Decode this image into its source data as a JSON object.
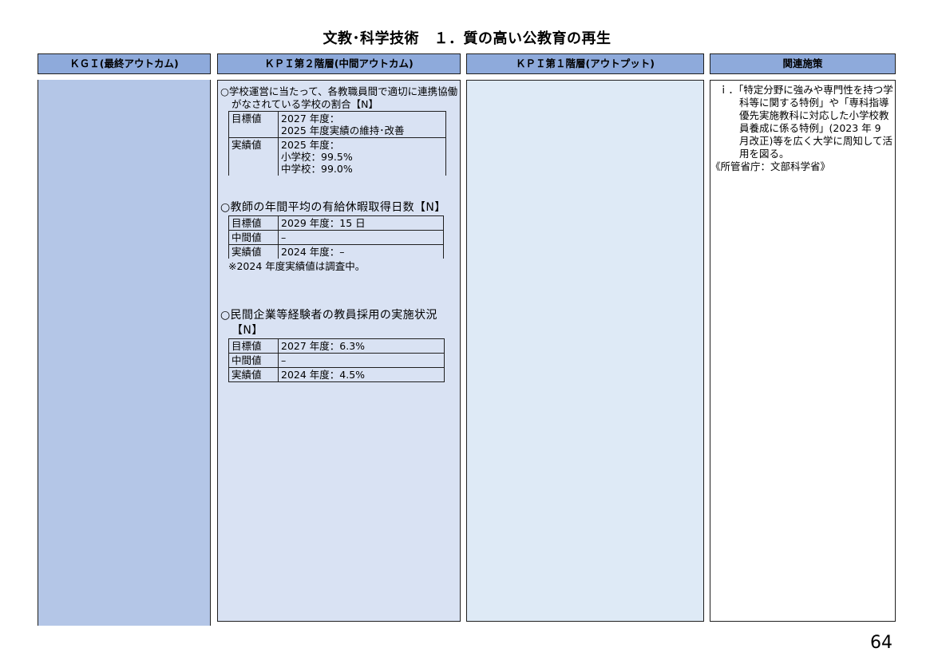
{
  "title": "文教･科学技術　１．質の高い公教育の再生",
  "headers": {
    "kgi": "ＫＧＩ(最終アウトカム)",
    "kpi2": "ＫＰＩ第２階層(中間アウトカム)",
    "kpi1": "ＫＰＩ第１階層(アウトプット)",
    "measures": "関連施策"
  },
  "kpi2": [
    {
      "title": "○学校運営に当たって、各教職員間で適切に連携協働がなされている学校の割合【N】",
      "rows": [
        {
          "key": "目標値",
          "lines": [
            "2027 年度：",
            "2025 年度実績の維持･改善"
          ]
        },
        {
          "key": "実績値",
          "lines": [
            "2025 年度：",
            "小学校：99.5%",
            "中学校：99.0%"
          ]
        }
      ]
    },
    {
      "title": "○教師の年間平均の有給休暇取得日数【N】",
      "rows": [
        {
          "key": "目標値",
          "lines": [
            "2029 年度：15 日"
          ]
        },
        {
          "key": "中間値",
          "lines": [
            "–"
          ]
        },
        {
          "key": "実績値",
          "lines": [
            "2024 年度：–"
          ]
        }
      ],
      "note": "※2024 年度実績値は調査中。"
    },
    {
      "title": "○民間企業等経験者の教員採用の実施状況【N】",
      "rows": [
        {
          "key": "目標値",
          "lines": [
            "2027 年度：6.3%"
          ]
        },
        {
          "key": "中間値",
          "lines": [
            "–"
          ]
        },
        {
          "key": "実績値",
          "lines": [
            "2024 年度：4.5%"
          ]
        }
      ]
    }
  ],
  "measures": {
    "item1": "ｉ．「特定分野に強みや専門性を持つ学科等に関する特例」や「専科指導優先実施教科に対応した小学校教員養成に係る特例」(2023 年 9 月改正)等を広く大学に周知して活用を図る。",
    "ministry": "《所管省庁：文部科学省》"
  },
  "page_number": "64"
}
